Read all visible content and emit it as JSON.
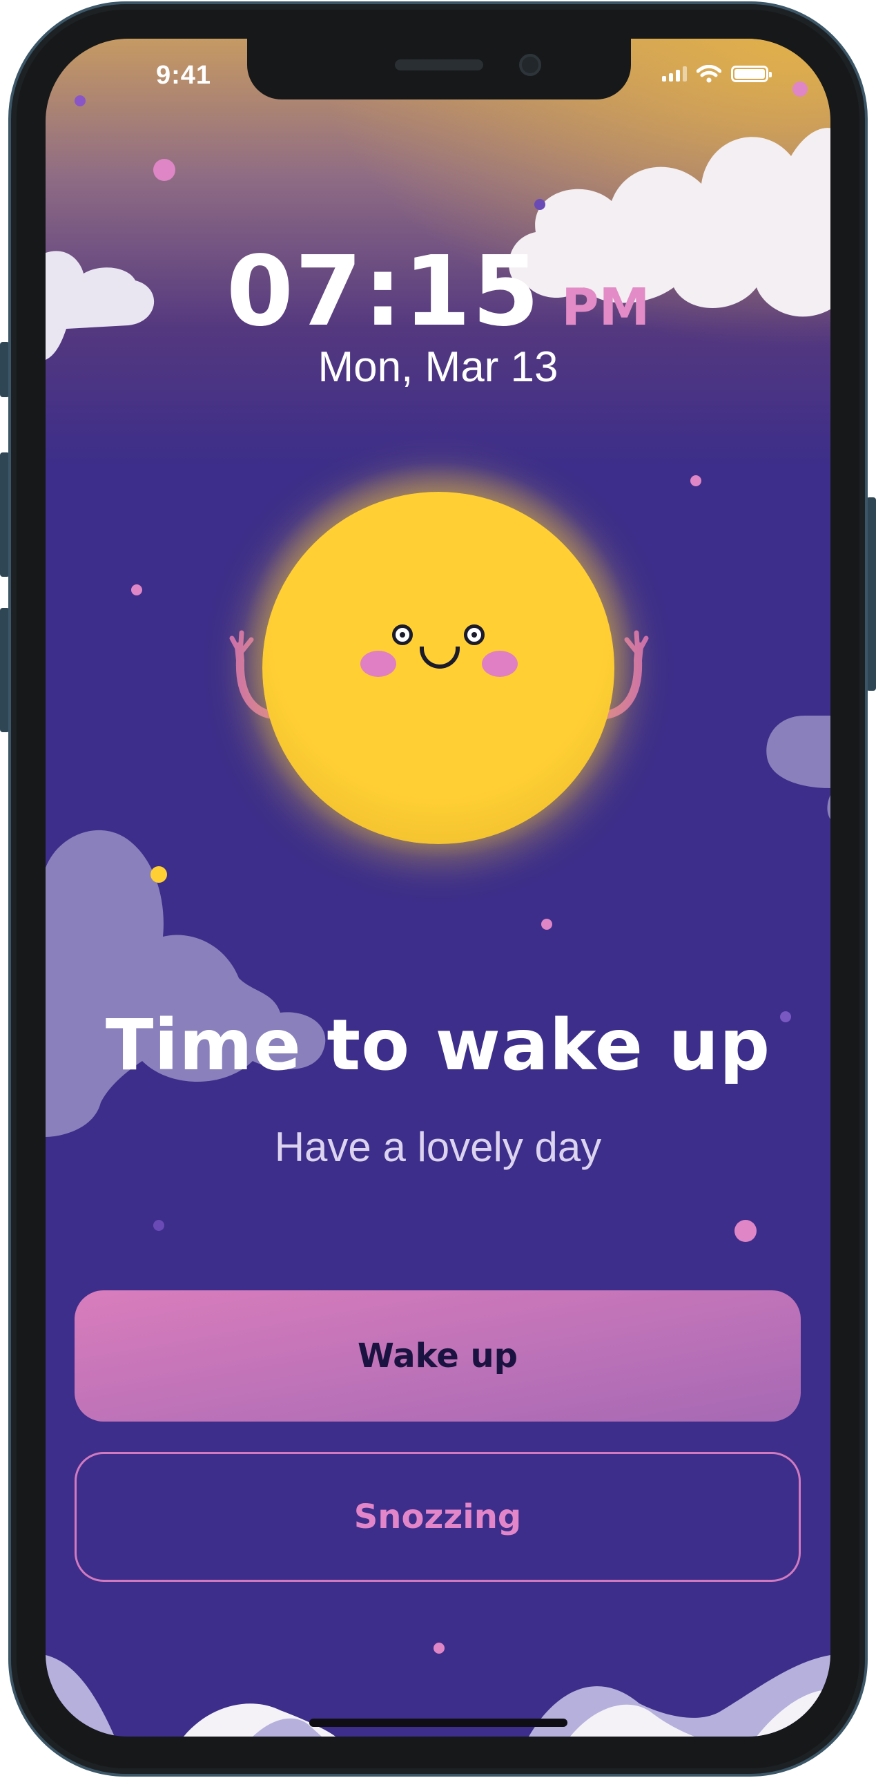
{
  "status_bar": {
    "time": "9:41",
    "icons": [
      "signal-icon",
      "wifi-icon",
      "battery-icon"
    ]
  },
  "alarm": {
    "time": "07:15",
    "meridiem": "PM",
    "date": "Mon, Mar 13"
  },
  "mascot": "smiling-sun-icon",
  "message": {
    "title": "Time to wake up",
    "subtitle": "Have a lovely day"
  },
  "actions": {
    "wake_label": "Wake up",
    "snooze_label": "Snozzing"
  },
  "colors": {
    "background": "#3c2e8a",
    "sun": "#ffcf34",
    "accent_pink": "#e38bc6",
    "button_gradient_start": "#d97dbc",
    "button_gradient_end": "#a669b4"
  }
}
